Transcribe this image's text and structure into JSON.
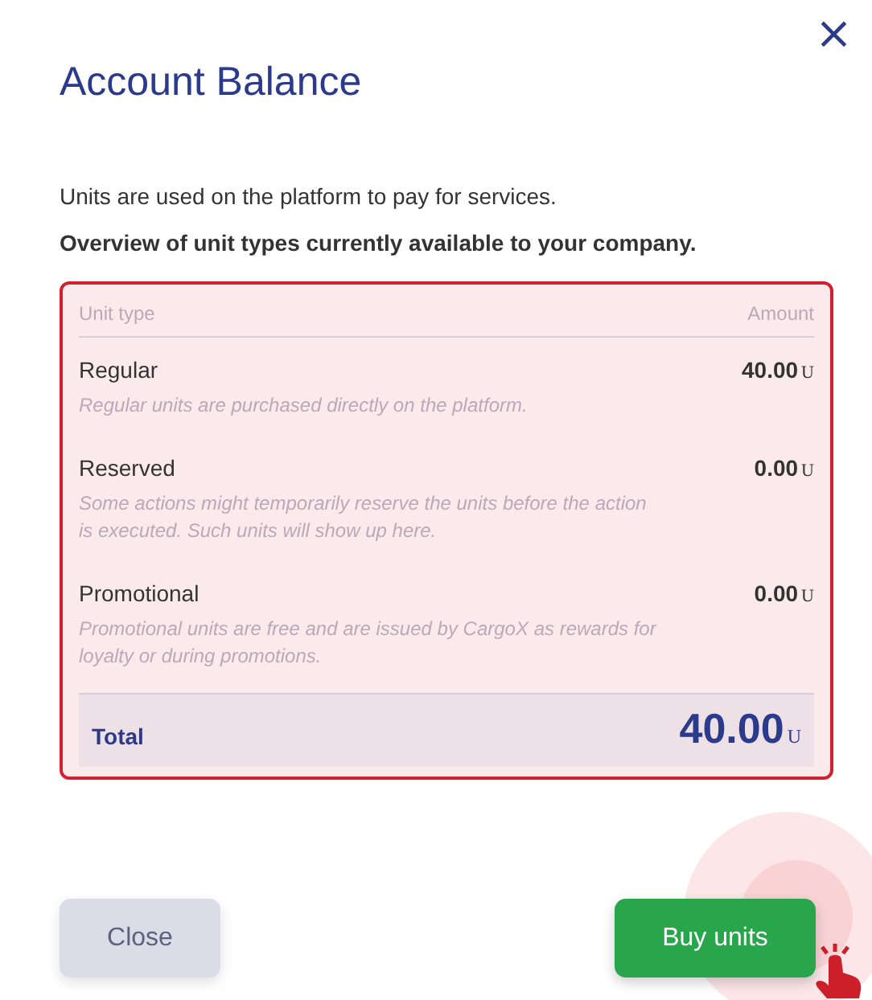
{
  "dialog": {
    "title": "Account Balance",
    "close_icon": "×",
    "intro": "Units are used on the platform to pay for services.",
    "subtitle": "Overview of unit types currently available to your company."
  },
  "table": {
    "columns": [
      "Unit type",
      "Amount"
    ],
    "rows": [
      {
        "name": "Regular",
        "description": "Regular units are purchased directly on the platform.",
        "amount": "40.00",
        "unit": "U"
      },
      {
        "name": "Reserved",
        "description": "Some actions might temporarily reserve the units before the action is executed. Such units will show up here.",
        "amount": "0.00",
        "unit": "U"
      },
      {
        "name": "Promotional",
        "description": "Promotional units are free and are issued by CargoX as rewards for loyalty or during promotions.",
        "amount": "0.00",
        "unit": "U"
      }
    ],
    "total": {
      "label": "Total",
      "amount": "40.00",
      "unit": "U"
    }
  },
  "buttons": [
    {
      "label": "Close",
      "kind": "secondary"
    },
    {
      "label": "Buy units",
      "kind": "primary"
    }
  ]
}
